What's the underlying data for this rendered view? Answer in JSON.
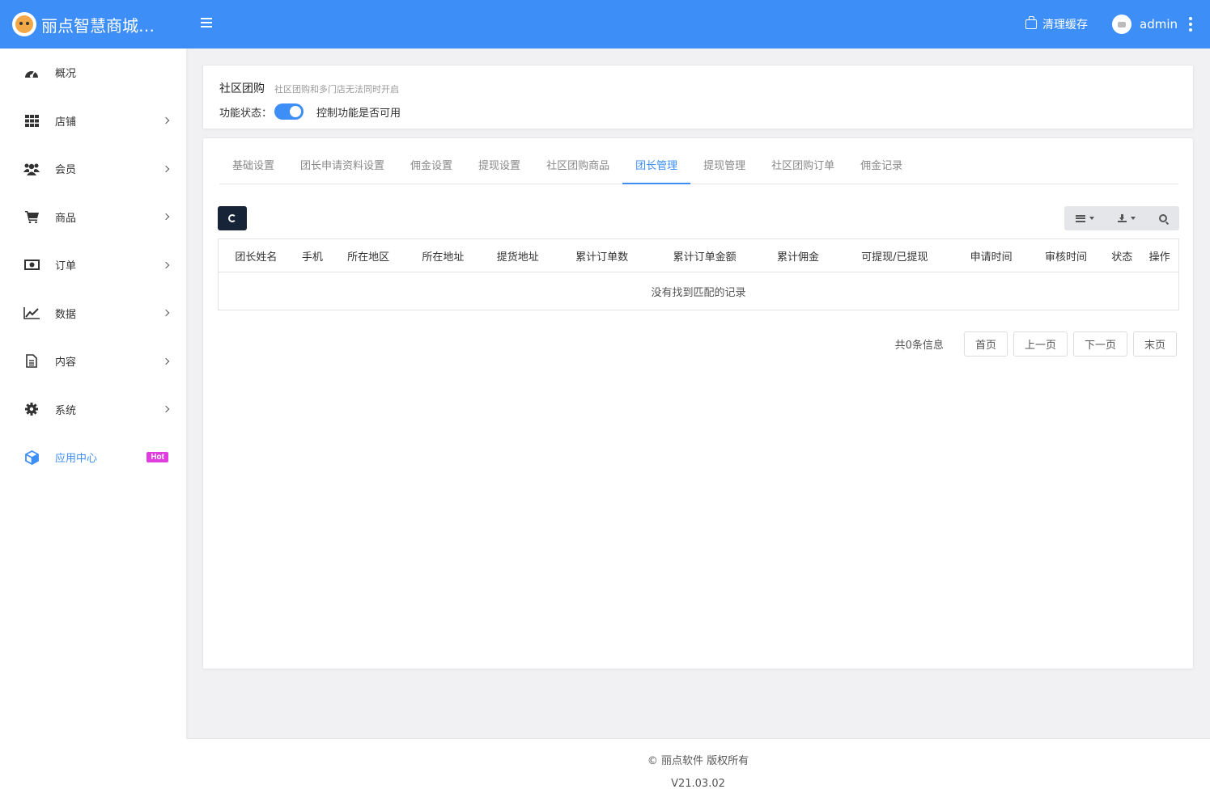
{
  "header": {
    "app_name": "丽点智慧商城演...",
    "clear_cache_label": "清理缓存",
    "username": "admin"
  },
  "sidebar": {
    "items": [
      {
        "label": "概况",
        "icon": "dashboard-icon"
      },
      {
        "label": "店铺",
        "icon": "grid-icon"
      },
      {
        "label": "会员",
        "icon": "users-icon"
      },
      {
        "label": "商品",
        "icon": "cart-icon"
      },
      {
        "label": "订单",
        "icon": "money-icon"
      },
      {
        "label": "数据",
        "icon": "chart-line-icon"
      },
      {
        "label": "内容",
        "icon": "document-icon"
      },
      {
        "label": "系统",
        "icon": "gear-icon"
      },
      {
        "label": "应用中心",
        "icon": "cube-icon",
        "badge": "Hot"
      }
    ]
  },
  "feature": {
    "title": "社区团购",
    "subtitle": "社区团购和多门店无法同时开启",
    "status_label": "功能状态：",
    "status_hint": "控制功能是否可用",
    "enabled": true
  },
  "tabs": [
    "基础设置",
    "团长申请资料设置",
    "佣金设置",
    "提现设置",
    "社区团购商品",
    "团长管理",
    "提现管理",
    "社区团购订单",
    "佣金记录"
  ],
  "active_tab": "团长管理",
  "table": {
    "columns": [
      "团长姓名",
      "手机",
      "所在地区",
      "所在地址",
      "提货地址",
      "累计订单数",
      "累计订单金额",
      "累计佣金",
      "可提现/已提现",
      "申请时间",
      "审核时间",
      "状态",
      "操作"
    ],
    "empty_text": "没有找到匹配的记录"
  },
  "pager": {
    "total_text": "共0条信息",
    "first": "首页",
    "prev": "上一页",
    "next": "下一页",
    "last": "末页"
  },
  "footer": {
    "copyright": "© 丽点软件 版权所有",
    "version": "V21.03.02"
  },
  "colors": {
    "primary": "#3d8ef7",
    "hot_badge": "#e03ce0",
    "dark_button": "#172437"
  }
}
